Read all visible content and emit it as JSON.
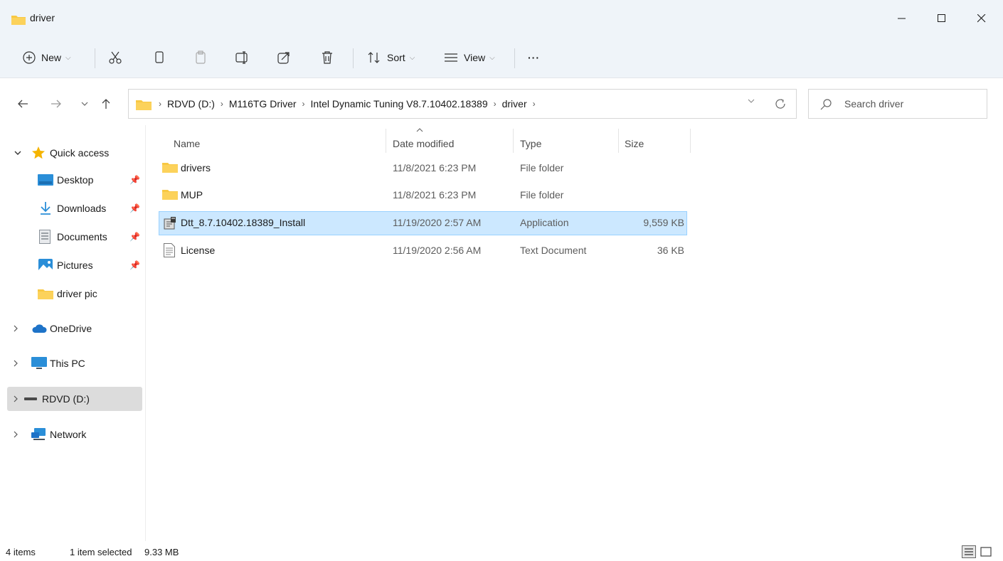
{
  "window": {
    "title": "driver",
    "minimize_glyph": "—",
    "maximize_glyph": "☐",
    "close_glyph": "✕"
  },
  "toolbar": {
    "new_label": "New",
    "sort_label": "Sort",
    "view_label": "View",
    "more_label": "···"
  },
  "address": {
    "crumbs": [
      "RDVD (D:)",
      "M116TG Driver",
      "Intel Dynamic Tuning V8.7.10402.18389",
      "driver"
    ],
    "separator": "›",
    "search_placeholder": "Search driver"
  },
  "sidebar": {
    "quick_access": "Quick access",
    "items": [
      {
        "label": "Desktop",
        "icon": "desktop-icon",
        "pinned": true
      },
      {
        "label": "Downloads",
        "icon": "downloads-icon",
        "pinned": true
      },
      {
        "label": "Documents",
        "icon": "documents-icon",
        "pinned": true
      },
      {
        "label": "Pictures",
        "icon": "pictures-icon",
        "pinned": true
      },
      {
        "label": "driver pic",
        "icon": "folder-icon",
        "pinned": false
      }
    ],
    "onedrive": "OneDrive",
    "this_pc": "This PC",
    "drive": "RDVD (D:)",
    "network": "Network"
  },
  "columns": {
    "name": "Name",
    "date_modified": "Date modified",
    "type": "Type",
    "size": "Size"
  },
  "files": [
    {
      "name": "drivers",
      "date": "11/8/2021 6:23 PM",
      "type": "File folder",
      "size": "",
      "icon": "folder-icon",
      "selected": false
    },
    {
      "name": "MUP",
      "date": "11/8/2021 6:23 PM",
      "type": "File folder",
      "size": "",
      "icon": "folder-icon",
      "selected": false
    },
    {
      "name": "Dtt_8.7.10402.18389_Install",
      "date": "11/19/2020 2:57 AM",
      "type": "Application",
      "size": "9,559 KB",
      "icon": "installer-icon",
      "selected": true
    },
    {
      "name": "License",
      "date": "11/19/2020 2:56 AM",
      "type": "Text Document",
      "size": "36 KB",
      "icon": "text-document-icon",
      "selected": false
    }
  ],
  "status": {
    "item_count": "4 items",
    "selection": "1 item selected",
    "selection_size": "9.33 MB"
  },
  "colors": {
    "chrome_bg": "#eff4f9",
    "selection_bg": "#cce8ff",
    "selection_border": "#99d1ff",
    "folder_yellow": "#f8c843",
    "sidebar_selected": "#dcdcdc"
  }
}
